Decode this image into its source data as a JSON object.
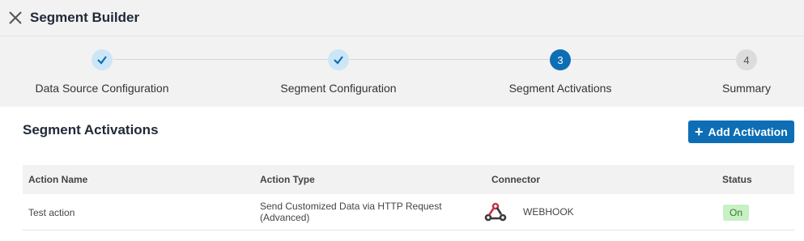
{
  "header": {
    "title": "Segment Builder"
  },
  "stepper": {
    "steps": [
      {
        "label": "Data Source Configuration",
        "state": "done"
      },
      {
        "label": "Segment Configuration",
        "state": "done"
      },
      {
        "label": "Segment Activations",
        "state": "active",
        "number": "3"
      },
      {
        "label": "Summary",
        "state": "pending",
        "number": "4"
      }
    ]
  },
  "section": {
    "title": "Segment Activations",
    "add_button_label": "Add Activation"
  },
  "table": {
    "columns": [
      "Action Name",
      "Action Type",
      "Connector",
      "Status"
    ],
    "rows": [
      {
        "action_name": "Test action",
        "action_type_line1": "Send Customized Data via HTTP Request",
        "action_type_line2": "(Advanced)",
        "connector": "WEBHOOK",
        "connector_icon": "webhook-icon",
        "status": "On"
      }
    ]
  },
  "colors": {
    "primary": "#0d6eb5",
    "done_step": "#cde6f7",
    "status_on_bg": "#c9f0c4",
    "webhook_red": "#c4354b"
  }
}
